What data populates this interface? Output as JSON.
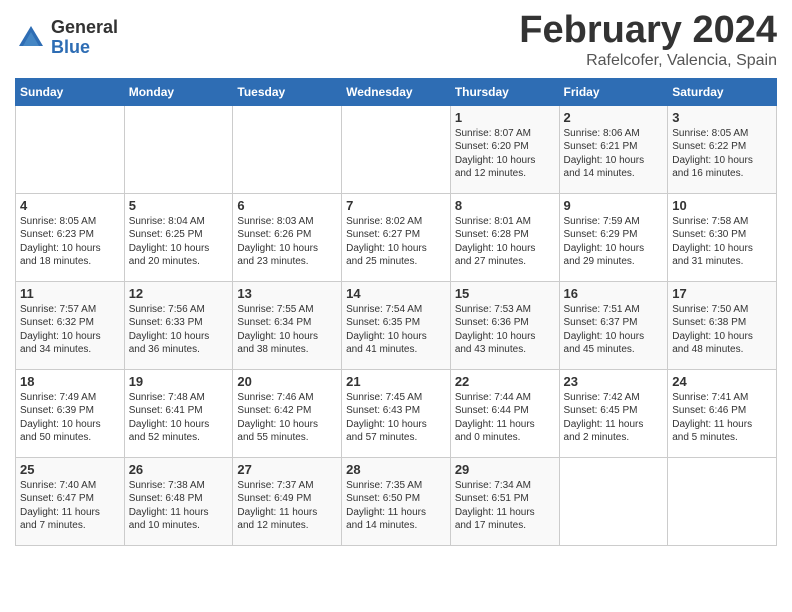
{
  "logo": {
    "general": "General",
    "blue": "Blue"
  },
  "title": {
    "month_year": "February 2024",
    "location": "Rafelcofer, Valencia, Spain"
  },
  "headers": [
    "Sunday",
    "Monday",
    "Tuesday",
    "Wednesday",
    "Thursday",
    "Friday",
    "Saturday"
  ],
  "weeks": [
    [
      {
        "day": "",
        "info": ""
      },
      {
        "day": "",
        "info": ""
      },
      {
        "day": "",
        "info": ""
      },
      {
        "day": "",
        "info": ""
      },
      {
        "day": "1",
        "info": "Sunrise: 8:07 AM\nSunset: 6:20 PM\nDaylight: 10 hours\nand 12 minutes."
      },
      {
        "day": "2",
        "info": "Sunrise: 8:06 AM\nSunset: 6:21 PM\nDaylight: 10 hours\nand 14 minutes."
      },
      {
        "day": "3",
        "info": "Sunrise: 8:05 AM\nSunset: 6:22 PM\nDaylight: 10 hours\nand 16 minutes."
      }
    ],
    [
      {
        "day": "4",
        "info": "Sunrise: 8:05 AM\nSunset: 6:23 PM\nDaylight: 10 hours\nand 18 minutes."
      },
      {
        "day": "5",
        "info": "Sunrise: 8:04 AM\nSunset: 6:25 PM\nDaylight: 10 hours\nand 20 minutes."
      },
      {
        "day": "6",
        "info": "Sunrise: 8:03 AM\nSunset: 6:26 PM\nDaylight: 10 hours\nand 23 minutes."
      },
      {
        "day": "7",
        "info": "Sunrise: 8:02 AM\nSunset: 6:27 PM\nDaylight: 10 hours\nand 25 minutes."
      },
      {
        "day": "8",
        "info": "Sunrise: 8:01 AM\nSunset: 6:28 PM\nDaylight: 10 hours\nand 27 minutes."
      },
      {
        "day": "9",
        "info": "Sunrise: 7:59 AM\nSunset: 6:29 PM\nDaylight: 10 hours\nand 29 minutes."
      },
      {
        "day": "10",
        "info": "Sunrise: 7:58 AM\nSunset: 6:30 PM\nDaylight: 10 hours\nand 31 minutes."
      }
    ],
    [
      {
        "day": "11",
        "info": "Sunrise: 7:57 AM\nSunset: 6:32 PM\nDaylight: 10 hours\nand 34 minutes."
      },
      {
        "day": "12",
        "info": "Sunrise: 7:56 AM\nSunset: 6:33 PM\nDaylight: 10 hours\nand 36 minutes."
      },
      {
        "day": "13",
        "info": "Sunrise: 7:55 AM\nSunset: 6:34 PM\nDaylight: 10 hours\nand 38 minutes."
      },
      {
        "day": "14",
        "info": "Sunrise: 7:54 AM\nSunset: 6:35 PM\nDaylight: 10 hours\nand 41 minutes."
      },
      {
        "day": "15",
        "info": "Sunrise: 7:53 AM\nSunset: 6:36 PM\nDaylight: 10 hours\nand 43 minutes."
      },
      {
        "day": "16",
        "info": "Sunrise: 7:51 AM\nSunset: 6:37 PM\nDaylight: 10 hours\nand 45 minutes."
      },
      {
        "day": "17",
        "info": "Sunrise: 7:50 AM\nSunset: 6:38 PM\nDaylight: 10 hours\nand 48 minutes."
      }
    ],
    [
      {
        "day": "18",
        "info": "Sunrise: 7:49 AM\nSunset: 6:39 PM\nDaylight: 10 hours\nand 50 minutes."
      },
      {
        "day": "19",
        "info": "Sunrise: 7:48 AM\nSunset: 6:41 PM\nDaylight: 10 hours\nand 52 minutes."
      },
      {
        "day": "20",
        "info": "Sunrise: 7:46 AM\nSunset: 6:42 PM\nDaylight: 10 hours\nand 55 minutes."
      },
      {
        "day": "21",
        "info": "Sunrise: 7:45 AM\nSunset: 6:43 PM\nDaylight: 10 hours\nand 57 minutes."
      },
      {
        "day": "22",
        "info": "Sunrise: 7:44 AM\nSunset: 6:44 PM\nDaylight: 11 hours\nand 0 minutes."
      },
      {
        "day": "23",
        "info": "Sunrise: 7:42 AM\nSunset: 6:45 PM\nDaylight: 11 hours\nand 2 minutes."
      },
      {
        "day": "24",
        "info": "Sunrise: 7:41 AM\nSunset: 6:46 PM\nDaylight: 11 hours\nand 5 minutes."
      }
    ],
    [
      {
        "day": "25",
        "info": "Sunrise: 7:40 AM\nSunset: 6:47 PM\nDaylight: 11 hours\nand 7 minutes."
      },
      {
        "day": "26",
        "info": "Sunrise: 7:38 AM\nSunset: 6:48 PM\nDaylight: 11 hours\nand 10 minutes."
      },
      {
        "day": "27",
        "info": "Sunrise: 7:37 AM\nSunset: 6:49 PM\nDaylight: 11 hours\nand 12 minutes."
      },
      {
        "day": "28",
        "info": "Sunrise: 7:35 AM\nSunset: 6:50 PM\nDaylight: 11 hours\nand 14 minutes."
      },
      {
        "day": "29",
        "info": "Sunrise: 7:34 AM\nSunset: 6:51 PM\nDaylight: 11 hours\nand 17 minutes."
      },
      {
        "day": "",
        "info": ""
      },
      {
        "day": "",
        "info": ""
      }
    ]
  ]
}
